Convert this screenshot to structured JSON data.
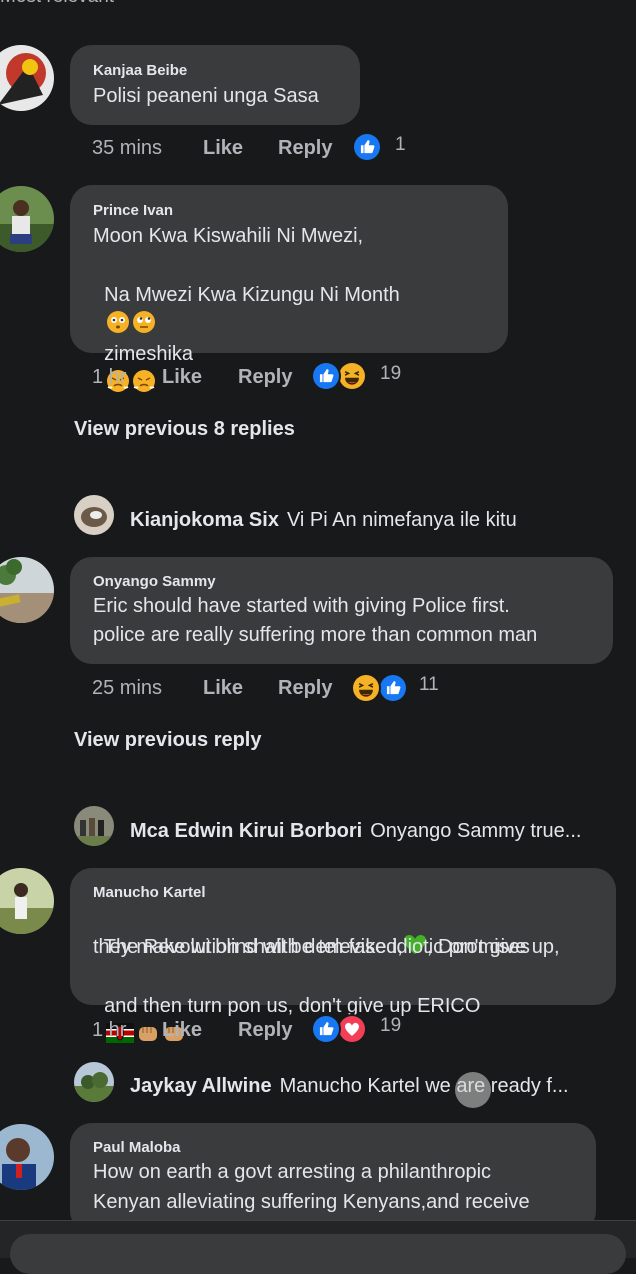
{
  "header": {
    "sort_label": "Most relevant"
  },
  "comments": [
    {
      "name": "Kanjaa Beibe",
      "text": "Polisi peaneni unga Sasa",
      "time": "35 mins",
      "like": "Like",
      "reply": "Reply",
      "reactions": [
        "like"
      ],
      "reaction_count": "1"
    },
    {
      "name": "Prince Ivan",
      "line1": "Moon Kwa Kiswahili Ni Mwezi,",
      "line2": "Na Mwezi Kwa Kizungu Ni Month",
      "line3": "zimeshika",
      "time": "1 hr",
      "like": "Like",
      "reply": "Reply",
      "reactions": [
        "like",
        "haha"
      ],
      "reaction_count": "19",
      "view_previous": "View previous 8 replies",
      "latest_reply": {
        "name": "Kianjokoma Six",
        "text": "Vi Pi An nimefanya ile kitu"
      }
    },
    {
      "name": "Onyango Sammy",
      "line1": "Eric should have started with giving Police first.",
      "line2": "police are really suffering more than common man",
      "time": "25 mins",
      "like": "Like",
      "reply": "Reply",
      "reactions": [
        "haha",
        "like"
      ],
      "reaction_count": "11",
      "view_previous": "View previous reply",
      "latest_reply": {
        "name": "Mca Edwin Kirui Borbori",
        "text": "Onyango Sammy true..."
      }
    },
    {
      "name": "Manucho Kartel",
      "line1": "The Revolution shall be televised,",
      "line1b": ", Don't give up,",
      "line2": "they make wi blind with dem fake idiotic promises",
      "line3": "and then turn pon us, don't give up ERICO",
      "time": "1 hr",
      "like": "Like",
      "reply": "Reply",
      "reactions": [
        "like",
        "love"
      ],
      "reaction_count": "19",
      "latest_reply": {
        "name": "Jaykay Allwine",
        "text": "Manucho Kartel we are ready f..."
      }
    },
    {
      "name": "Paul Maloba",
      "line1": "How on earth a govt arresting a philanthropic",
      "line2": "Kenyan alleviating suffering Kenyans,and receive"
    }
  ],
  "colors": {
    "background": "#18191a",
    "bubble": "#3a3b3c",
    "like_blue": "#1877f2",
    "love_red": "#f33e58",
    "haha_yellow": "#f7b125"
  },
  "icons": [
    "chevron-down-icon",
    "like-reaction-icon",
    "haha-reaction-icon",
    "love-reaction-icon",
    "flushed-emoji",
    "eye-roll-emoji",
    "triumph-emoji",
    "green-heart-emoji",
    "kenya-flag-emoji",
    "fist-emoji"
  ]
}
